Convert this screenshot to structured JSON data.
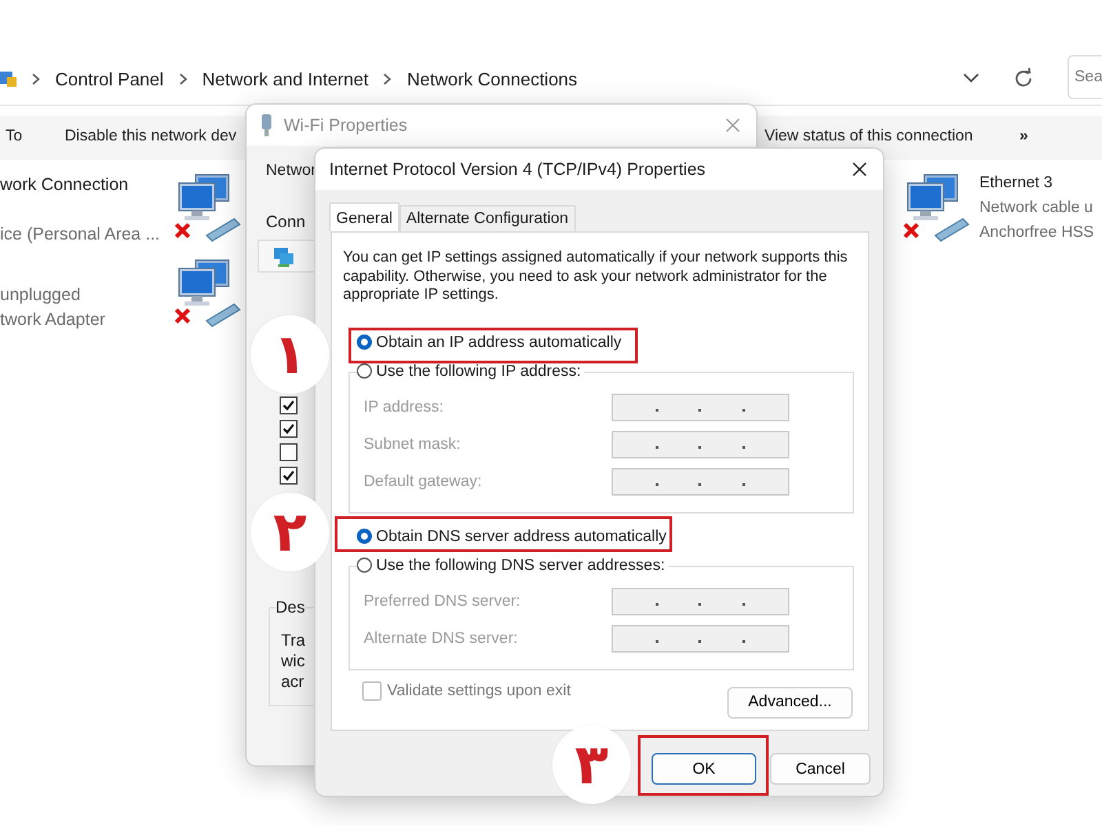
{
  "explorer": {
    "breadcrumb": [
      "Control Panel",
      "Network and Internet",
      "Network Connections"
    ],
    "search": {
      "placeholder": "Sea"
    },
    "commands": [
      "To",
      "Disable this network dev",
      "View status of this connection",
      "»"
    ],
    "left_connections": [
      {
        "lines": [
          {
            "kind": "name",
            "text": "work Connection"
          },
          {
            "kind": "device",
            "text": "ice (Personal Area ..."
          }
        ]
      },
      {
        "lines": [
          {
            "kind": "status",
            "text": "unplugged"
          },
          {
            "kind": "device",
            "text": "twork Adapter"
          }
        ]
      }
    ],
    "right_connections": [
      {
        "lines": [
          {
            "kind": "name",
            "text": "Ethernet 3"
          },
          {
            "kind": "status",
            "text": "Network cable u"
          },
          {
            "kind": "device",
            "text": "Anchorfree HSS"
          }
        ]
      }
    ]
  },
  "wifi_properties": {
    "title": "Wi-Fi Properties",
    "tab": "Networ",
    "connect_label": "Conn",
    "items": [
      {
        "checked": true
      },
      {
        "checked": true
      },
      {
        "checked": false
      },
      {
        "checked": true
      }
    ],
    "description_label": "Des",
    "description_lines": [
      "Tra",
      "wic",
      "acr"
    ]
  },
  "ipv4_dialog": {
    "title": "Internet Protocol Version 4 (TCP/IPv4) Properties",
    "tabs": [
      {
        "label": "General",
        "selected": true
      },
      {
        "label": "Alternate Configuration",
        "selected": false
      }
    ],
    "description": "You can get IP settings assigned automatically if your network supports this capability. Otherwise, you need to ask your network administrator for the appropriate IP settings.",
    "ip": {
      "auto": {
        "label": "Obtain an IP address automatically",
        "selected": true
      },
      "manual": {
        "label": "Use the following IP address:",
        "selected": false
      },
      "disabled": true,
      "fields": [
        {
          "label": "IP address:"
        },
        {
          "label": "Subnet mask:"
        },
        {
          "label": "Default gateway:"
        }
      ]
    },
    "dns": {
      "auto": {
        "label": "Obtain DNS server address automatically",
        "selected": true
      },
      "manual": {
        "label": "Use the following DNS server addresses:",
        "selected": false
      },
      "disabled": true,
      "fields": [
        {
          "label": "Preferred DNS server:"
        },
        {
          "label": "Alternate DNS server:"
        }
      ]
    },
    "validate": {
      "label": "Validate settings upon exit",
      "checked": false,
      "disabled": true
    },
    "buttons": [
      {
        "kind": "advanced",
        "label": "Advanced..."
      },
      {
        "kind": "ok",
        "label": "OK"
      },
      {
        "kind": "cancel",
        "label": "Cancel"
      }
    ]
  },
  "annotations": [
    {
      "number": "۱"
    },
    {
      "number": "۲"
    },
    {
      "number": "۳"
    }
  ]
}
